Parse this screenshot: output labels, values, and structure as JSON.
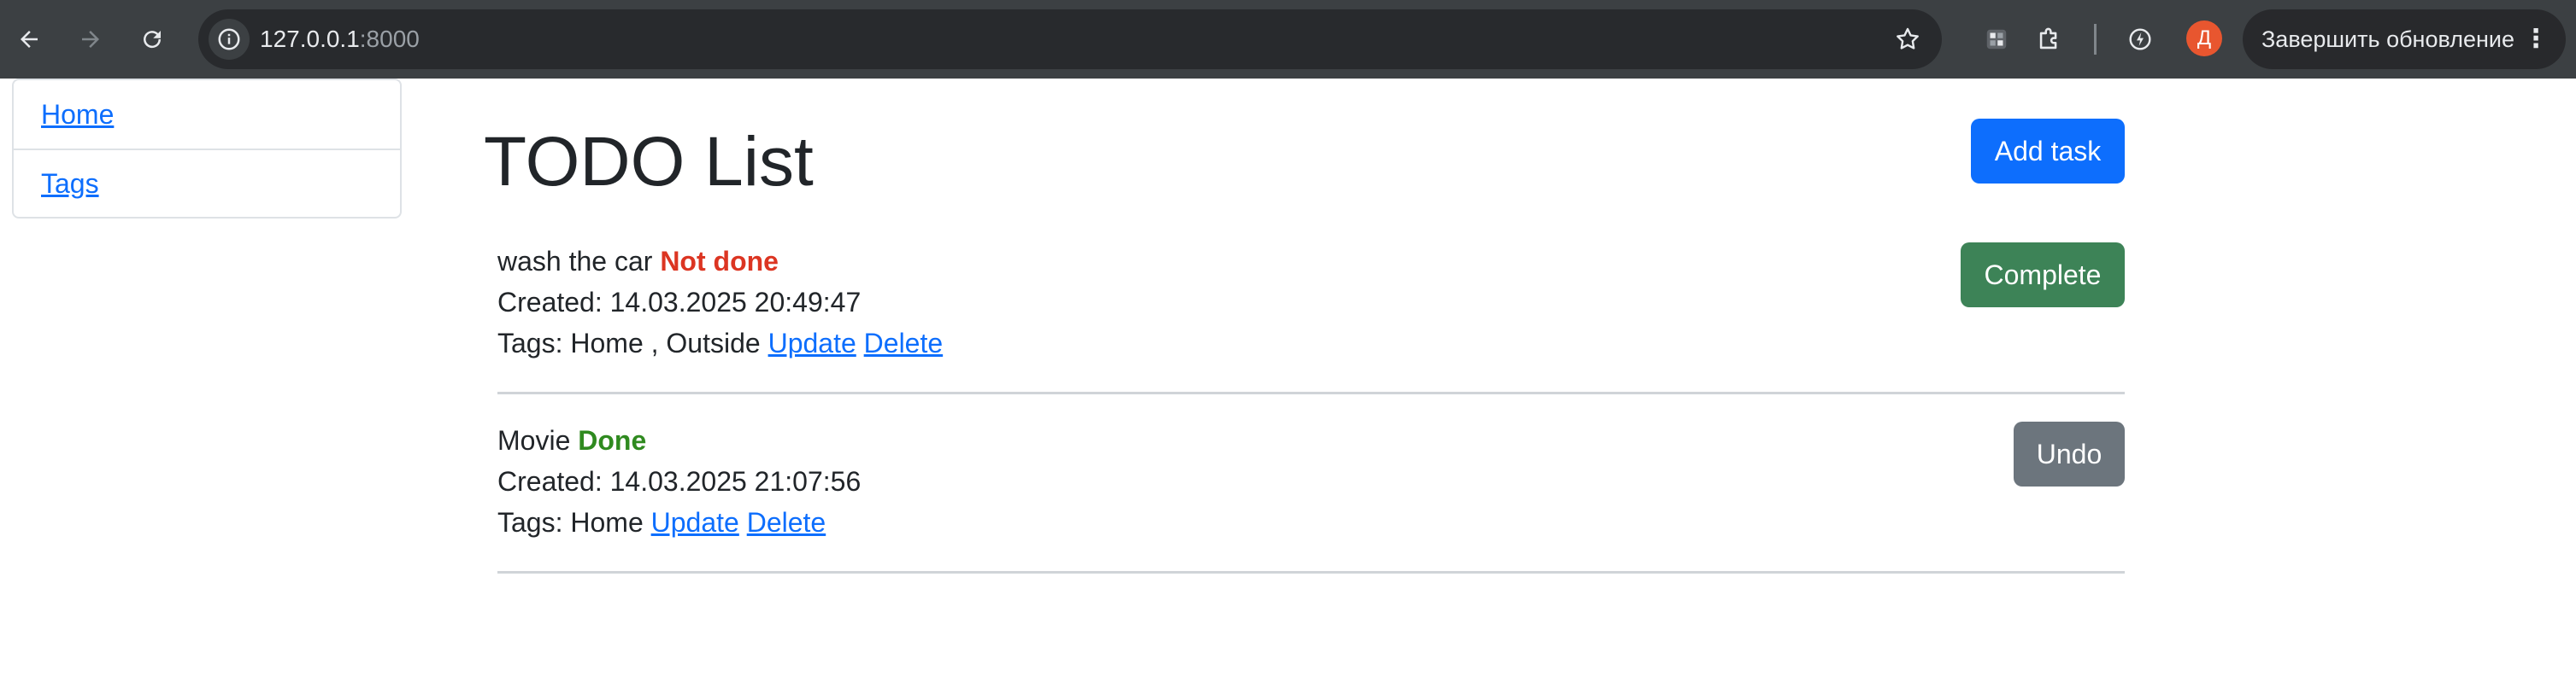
{
  "browser": {
    "url_host": "127.0.0.1",
    "url_port": ":8000",
    "profile_initial": "Д",
    "update_label": "Завершить обновление"
  },
  "sidebar": {
    "items": [
      {
        "label": "Home"
      },
      {
        "label": "Tags"
      }
    ]
  },
  "main": {
    "title": "TODO List",
    "add_task_label": "Add task",
    "tasks": [
      {
        "name": "wash the car",
        "status": "Not done",
        "created": "Created: 14.03.2025 20:49:47",
        "tags_text": "Tags: Home , Outside",
        "update_label": "Update",
        "delete_label": "Delete",
        "action_label": "Complete"
      },
      {
        "name": "Movie",
        "status": "Done",
        "created": "Created: 14.03.2025 21:07:56",
        "tags_text": "Tags: Home",
        "update_label": "Update",
        "delete_label": "Delete",
        "action_label": "Undo"
      }
    ]
  },
  "colors": {
    "primary": "#0d6efd",
    "success": "#3d8357",
    "secondary": "#6c757d",
    "not_done": "#dc3522",
    "done": "#2f8a1f"
  },
  "icons": [
    "back-arrow-icon",
    "forward-arrow-icon",
    "reload-icon",
    "site-info-icon",
    "bookmark-star-icon",
    "extension-grid-icon",
    "extensions-puzzle-icon",
    "performance-icon",
    "kebab-menu-icon"
  ]
}
